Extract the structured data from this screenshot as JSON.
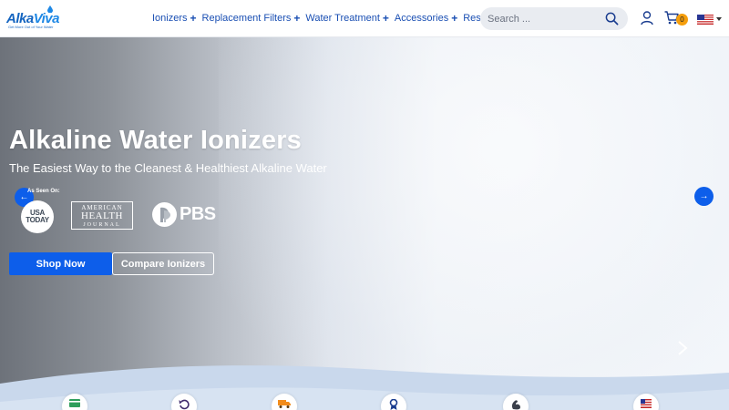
{
  "brand": {
    "name_part1": "Alka",
    "name_part2": "Viva",
    "tagline": "Get More Out of Your Water"
  },
  "nav": {
    "items": [
      {
        "label": "Ionizers",
        "expand": "+"
      },
      {
        "label": "Replacement Filters",
        "expand": "+"
      },
      {
        "label": "Water Treatment",
        "expand": "+"
      },
      {
        "label": "Accessories",
        "expand": "+"
      },
      {
        "label": "Resources",
        "expand": "+"
      }
    ]
  },
  "search": {
    "placeholder": "Search ...",
    "icon": "search-icon"
  },
  "header_actions": {
    "account_icon": "user-icon",
    "cart_icon": "cart-icon",
    "cart_count": "0",
    "locale_icon": "us-flag-icon"
  },
  "hero": {
    "title": "Alkaline Water Ionizers",
    "subtitle": "The Easiest Way to the Cleanest & Healthiest Alkaline Water",
    "seen_on": "As Seen On:",
    "press": {
      "usa_today_line1": "USA",
      "usa_today_line2": "TODAY",
      "ahj_line1": "AMERICAN",
      "ahj_line2": "HEALTH",
      "ahj_line3": "JOURNAL",
      "pbs": "PBS"
    },
    "primary_cta": "Shop Now",
    "secondary_cta": "Compare Ionizers",
    "prev_arrow": "←",
    "next_arrow": "→"
  },
  "colors": {
    "brand_blue": "#1a4fb3",
    "cta_blue": "#0d5eea",
    "cart_badge": "#f59e0b"
  },
  "feature_icons": [
    "card-icon",
    "return-icon",
    "shipping-icon",
    "award-icon",
    "strength-icon",
    "usa-icon"
  ]
}
